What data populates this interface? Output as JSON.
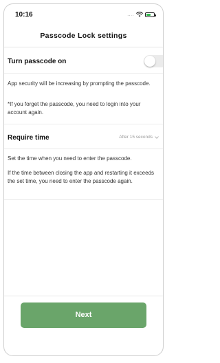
{
  "status_bar": {
    "time": "10:16",
    "signal": "....",
    "battery_color": "#2fb84a"
  },
  "header": {
    "title": "Passcode Lock settings"
  },
  "passcode": {
    "label": "Turn passcode on",
    "toggle_on": false,
    "description": "App security will be increasing by prompting the passcode.",
    "note": "*If you forget the passcode, you need to login into your account again."
  },
  "require_time": {
    "label": "Require time",
    "value": "After 15 seconds",
    "description_1": "Set the time when you need to enter the passcode.",
    "description_2": "If the time between closing the app and restarting it exceeds the set time, you need to enter the passcode again."
  },
  "footer": {
    "next_label": "Next",
    "accent_color": "#6aa56a"
  }
}
